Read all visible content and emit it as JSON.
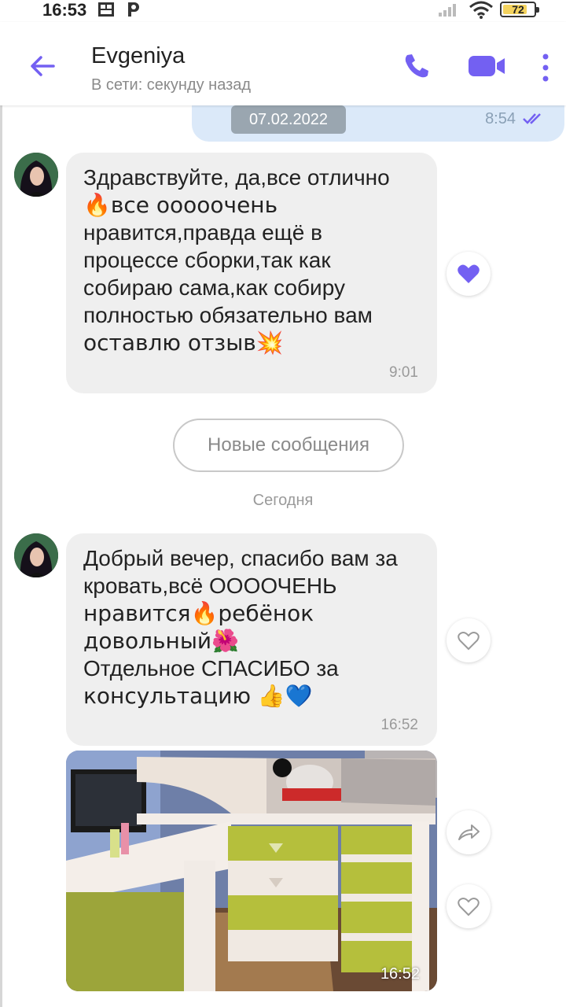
{
  "status_bar": {
    "time": "16:53",
    "battery": "72",
    "icons": [
      "gallery-notification-icon",
      "p-app-notification-icon",
      "signal-icon",
      "wifi-icon",
      "battery-icon"
    ]
  },
  "header": {
    "contact_name": "Evgeniya",
    "status": "В сети: секунду назад",
    "icons": [
      "back-arrow-icon",
      "phone-icon",
      "video-camera-icon",
      "more-vertical-icon"
    ],
    "accent_color": "#7360f2"
  },
  "outgoing_partial": {
    "time": "8:54",
    "date_chip": "07.02.2022"
  },
  "messages": [
    {
      "lines": [
        "Здравствуйте, да,все отлично",
        "🔥все ооооочень",
        "нравится,правда ещё в",
        "процессе сборки,так как",
        "собираю сама,как собиру",
        "полностью обязательно вам",
        "оставлю отзыв💥"
      ],
      "time": "9:01",
      "liked": true
    },
    {
      "lines": [
        "Добрый вечер, спасибо вам за",
        "кровать,всё ООООЧЕНЬ",
        "нравится🔥ребёнок",
        "довольный🌺",
        "Отдельное СПАСИБО за",
        "консультацию 👍💙"
      ],
      "time": "16:52",
      "liked": false
    }
  ],
  "photo_message": {
    "time": "16:52"
  },
  "dividers": {
    "new_messages": "Новые сообщения",
    "today": "Сегодня"
  }
}
